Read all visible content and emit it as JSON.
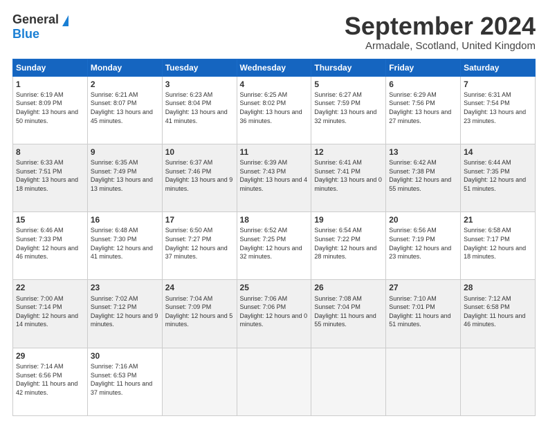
{
  "logo": {
    "line1": "General",
    "line2": "Blue"
  },
  "header": {
    "month": "September 2024",
    "location": "Armadale, Scotland, United Kingdom"
  },
  "weekdays": [
    "Sunday",
    "Monday",
    "Tuesday",
    "Wednesday",
    "Thursday",
    "Friday",
    "Saturday"
  ],
  "weeks": [
    [
      {
        "num": "1",
        "sunrise": "6:19 AM",
        "sunset": "8:09 PM",
        "daylight": "13 hours and 50 minutes."
      },
      {
        "num": "2",
        "sunrise": "6:21 AM",
        "sunset": "8:07 PM",
        "daylight": "13 hours and 45 minutes."
      },
      {
        "num": "3",
        "sunrise": "6:23 AM",
        "sunset": "8:04 PM",
        "daylight": "13 hours and 41 minutes."
      },
      {
        "num": "4",
        "sunrise": "6:25 AM",
        "sunset": "8:02 PM",
        "daylight": "13 hours and 36 minutes."
      },
      {
        "num": "5",
        "sunrise": "6:27 AM",
        "sunset": "7:59 PM",
        "daylight": "13 hours and 32 minutes."
      },
      {
        "num": "6",
        "sunrise": "6:29 AM",
        "sunset": "7:56 PM",
        "daylight": "13 hours and 27 minutes."
      },
      {
        "num": "7",
        "sunrise": "6:31 AM",
        "sunset": "7:54 PM",
        "daylight": "13 hours and 23 minutes."
      }
    ],
    [
      {
        "num": "8",
        "sunrise": "6:33 AM",
        "sunset": "7:51 PM",
        "daylight": "13 hours and 18 minutes."
      },
      {
        "num": "9",
        "sunrise": "6:35 AM",
        "sunset": "7:49 PM",
        "daylight": "13 hours and 13 minutes."
      },
      {
        "num": "10",
        "sunrise": "6:37 AM",
        "sunset": "7:46 PM",
        "daylight": "13 hours and 9 minutes."
      },
      {
        "num": "11",
        "sunrise": "6:39 AM",
        "sunset": "7:43 PM",
        "daylight": "13 hours and 4 minutes."
      },
      {
        "num": "12",
        "sunrise": "6:41 AM",
        "sunset": "7:41 PM",
        "daylight": "13 hours and 0 minutes."
      },
      {
        "num": "13",
        "sunrise": "6:42 AM",
        "sunset": "7:38 PM",
        "daylight": "12 hours and 55 minutes."
      },
      {
        "num": "14",
        "sunrise": "6:44 AM",
        "sunset": "7:35 PM",
        "daylight": "12 hours and 51 minutes."
      }
    ],
    [
      {
        "num": "15",
        "sunrise": "6:46 AM",
        "sunset": "7:33 PM",
        "daylight": "12 hours and 46 minutes."
      },
      {
        "num": "16",
        "sunrise": "6:48 AM",
        "sunset": "7:30 PM",
        "daylight": "12 hours and 41 minutes."
      },
      {
        "num": "17",
        "sunrise": "6:50 AM",
        "sunset": "7:27 PM",
        "daylight": "12 hours and 37 minutes."
      },
      {
        "num": "18",
        "sunrise": "6:52 AM",
        "sunset": "7:25 PM",
        "daylight": "12 hours and 32 minutes."
      },
      {
        "num": "19",
        "sunrise": "6:54 AM",
        "sunset": "7:22 PM",
        "daylight": "12 hours and 28 minutes."
      },
      {
        "num": "20",
        "sunrise": "6:56 AM",
        "sunset": "7:19 PM",
        "daylight": "12 hours and 23 minutes."
      },
      {
        "num": "21",
        "sunrise": "6:58 AM",
        "sunset": "7:17 PM",
        "daylight": "12 hours and 18 minutes."
      }
    ],
    [
      {
        "num": "22",
        "sunrise": "7:00 AM",
        "sunset": "7:14 PM",
        "daylight": "12 hours and 14 minutes."
      },
      {
        "num": "23",
        "sunrise": "7:02 AM",
        "sunset": "7:12 PM",
        "daylight": "12 hours and 9 minutes."
      },
      {
        "num": "24",
        "sunrise": "7:04 AM",
        "sunset": "7:09 PM",
        "daylight": "12 hours and 5 minutes."
      },
      {
        "num": "25",
        "sunrise": "7:06 AM",
        "sunset": "7:06 PM",
        "daylight": "12 hours and 0 minutes."
      },
      {
        "num": "26",
        "sunrise": "7:08 AM",
        "sunset": "7:04 PM",
        "daylight": "11 hours and 55 minutes."
      },
      {
        "num": "27",
        "sunrise": "7:10 AM",
        "sunset": "7:01 PM",
        "daylight": "11 hours and 51 minutes."
      },
      {
        "num": "28",
        "sunrise": "7:12 AM",
        "sunset": "6:58 PM",
        "daylight": "11 hours and 46 minutes."
      }
    ],
    [
      {
        "num": "29",
        "sunrise": "7:14 AM",
        "sunset": "6:56 PM",
        "daylight": "11 hours and 42 minutes."
      },
      {
        "num": "30",
        "sunrise": "7:16 AM",
        "sunset": "6:53 PM",
        "daylight": "11 hours and 37 minutes."
      },
      null,
      null,
      null,
      null,
      null
    ]
  ]
}
